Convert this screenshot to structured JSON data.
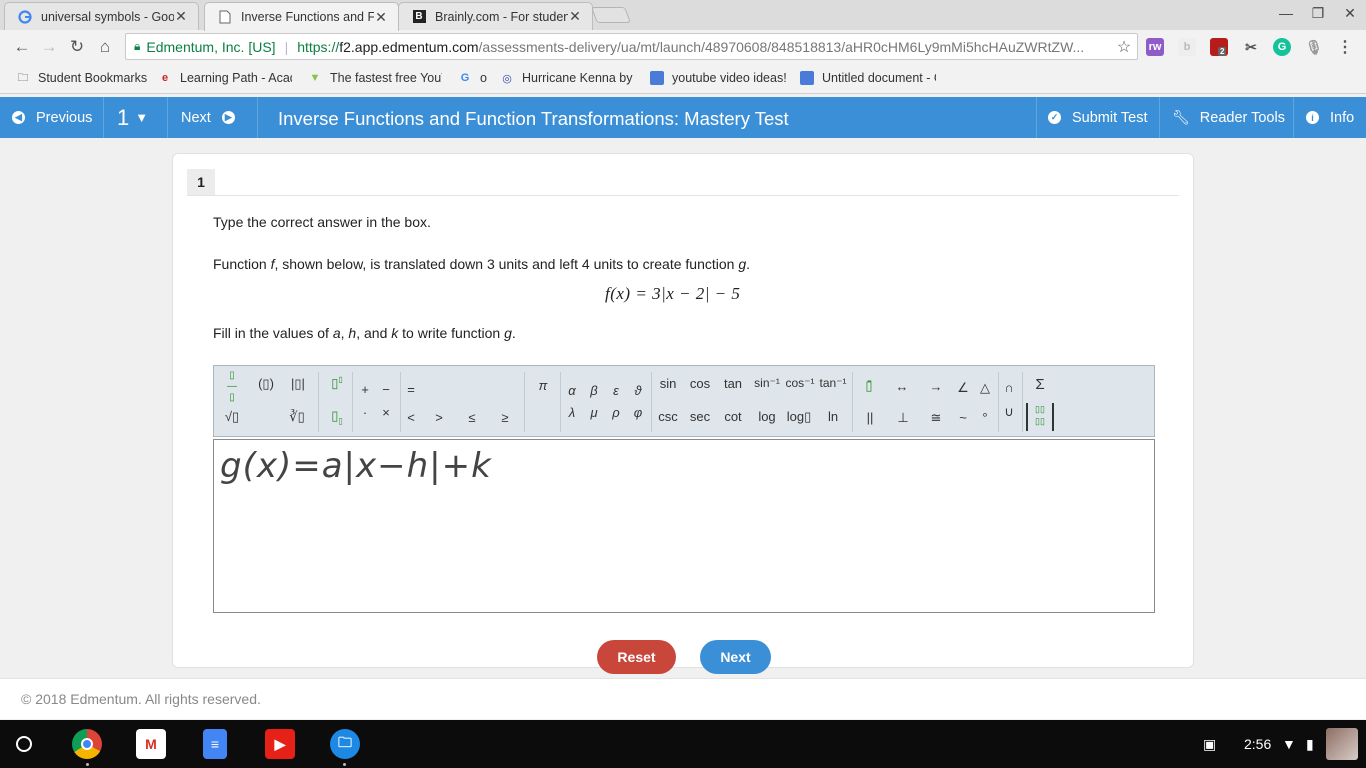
{
  "browser": {
    "tabs": [
      {
        "title": "universal symbols - Goog",
        "favicon": "google-icon"
      },
      {
        "title": "Inverse Functions and Fu",
        "favicon": "page-icon"
      },
      {
        "title": "Brainly.com - For student",
        "favicon": "brainly-icon"
      }
    ],
    "address": {
      "org": "Edmentum, Inc. [US]",
      "scheme": "https://",
      "host": "f2.app.edmentum.com",
      "path": "/assessments-delivery/ua/mt/launch/48970608/848518813/aHR0cHM6Ly9mMi5hcHAuZWRtZW..."
    },
    "extension_badge": "2",
    "bookmarks": [
      {
        "label": "Student Bookmarks",
        "icon": "folder-icon"
      },
      {
        "label": "Learning Path - Acad",
        "icon": "edmentum-icon"
      },
      {
        "label": "The fastest free YouT",
        "icon": "download-icon"
      },
      {
        "label": "o",
        "icon": "google-icon"
      },
      {
        "label": "Hurricane Kenna by S",
        "icon": "globe-icon"
      },
      {
        "label": "youtube video ideas!",
        "icon": "doc-icon"
      },
      {
        "label": "Untitled document - G",
        "icon": "doc-icon"
      }
    ]
  },
  "nav": {
    "previous": "Previous",
    "question_number": "1",
    "next": "Next",
    "title": "Inverse Functions and Function Transformations: Mastery Test",
    "submit": "Submit Test",
    "reader_tools": "Reader Tools",
    "info": "Info",
    "accent": "#3b8fd6"
  },
  "question": {
    "number": "1",
    "instruction": "Type the correct answer in the box.",
    "prompt_parts": [
      "Function ",
      "f",
      ", shown below, is translated down 3 units and left 4 units to create function ",
      "g",
      "."
    ],
    "formula": "f(x)  =  3|x  −  2|  −  5",
    "fill_parts": [
      "Fill in the values of ",
      "a",
      ", ",
      "h",
      ", and ",
      "k",
      " to write function ",
      "g",
      "."
    ],
    "answer_template": "g(x)=a|x−h|+k"
  },
  "equation_toolbar": {
    "row1": [
      "(▯)",
      "|▯|",
      "+",
      "−",
      "=",
      "π",
      "α",
      "β",
      "ε",
      "ϑ",
      "sin",
      "cos",
      "tan",
      "sin⁻¹",
      "cos⁻¹",
      "tan⁻¹",
      "↔",
      "→",
      "∠",
      "△",
      "∩",
      "Σ"
    ],
    "row2": [
      "√▯",
      "∛▯",
      "·",
      "×",
      "<",
      ">",
      "≤",
      "≥",
      "λ",
      "μ",
      "ρ",
      "φ",
      "csc",
      "sec",
      "cot",
      "log",
      "log▯",
      "ln",
      "||",
      "⊥",
      "≅",
      "~",
      "°",
      "∪"
    ]
  },
  "buttons": {
    "reset": "Reset",
    "next": "Next",
    "reset_color": "#c9473a"
  },
  "footer": "© 2018 Edmentum. All rights reserved.",
  "shelf": {
    "time": "2:56"
  }
}
